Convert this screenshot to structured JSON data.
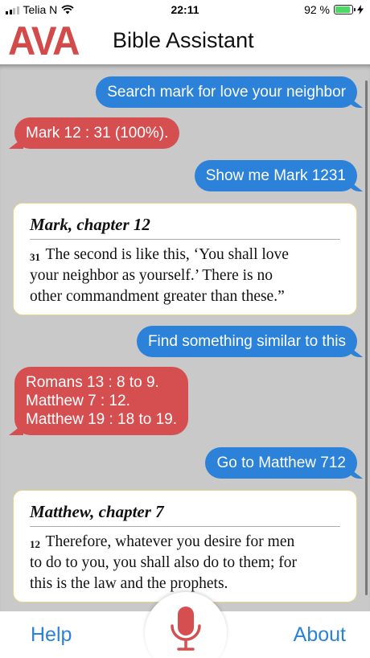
{
  "status_bar": {
    "carrier": "Telia N",
    "time": "22:11",
    "battery": "92 %",
    "battery_level": 0.92
  },
  "header": {
    "logo": "AVA",
    "title": "Bible Assistant"
  },
  "messages": {
    "m1": "Search mark for love your neighbor",
    "r1": "Mark 12 : 31 (100%).",
    "m2": "Show me Mark 1231",
    "card1": {
      "title": "Mark, chapter 12",
      "verse": "31",
      "line1": "The second is like this, ‘You shall love",
      "line2": "your neighbor as yourself.’ There is no",
      "line3": "other commandment greater than these.”"
    },
    "m3": "Find something similar to this",
    "r2": {
      "line1": "Romans 13 : 8 to 9.",
      "line2": "Matthew 7 : 12.",
      "line3": "Matthew 19 : 18 to 19."
    },
    "m4": "Go to Matthew 712",
    "card2": {
      "title": "Matthew, chapter 7",
      "verse": "12",
      "line1": "Therefore, whatever you desire for men",
      "line2": "to do to you, you shall also do to them; for",
      "line3": "this is the law and the prophets."
    }
  },
  "bottom_bar": {
    "help": "Help",
    "about": "About",
    "mic_icon": "microphone-icon"
  },
  "colors": {
    "user_bubble": "#2b82d8",
    "assistant_bubble": "#d54f51",
    "logo": "#d24a4a"
  }
}
